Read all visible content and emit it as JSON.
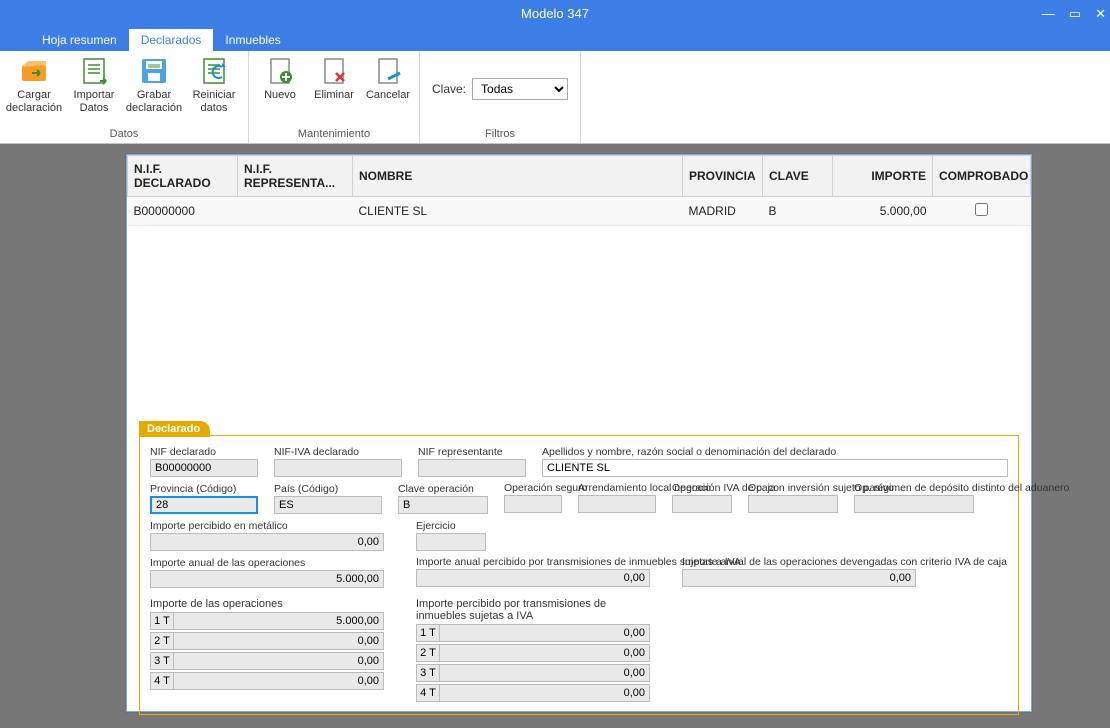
{
  "title": "Modelo 347",
  "tabs": {
    "resumen": "Hoja resumen",
    "declarados": "Declarados",
    "inmuebles": "Inmuebles"
  },
  "ribbon": {
    "datos": {
      "label": "Datos",
      "cargar": "Cargar declaración",
      "importar": "Importar Datos",
      "grabar": "Grabar declaración",
      "reiniciar": "Reiniciar datos"
    },
    "mant": {
      "label": "Mantenimiento",
      "nuevo": "Nuevo",
      "eliminar": "Eliminar",
      "cancelar": "Cancelar"
    },
    "filtros": {
      "label": "Filtros",
      "clave": "Clave:",
      "todas": "Todas"
    }
  },
  "grid": {
    "headers": {
      "nif": "N.I.F. DECLARADO",
      "nifrep": "N.I.F. REPRESENTA...",
      "nombre": "NOMBRE",
      "prov": "PROVINCIA",
      "clave": "CLAVE",
      "importe": "IMPORTE",
      "comp": "COMPROBADO"
    },
    "rows": [
      {
        "nif": "B00000000",
        "nifrep": "",
        "nombre": "CLIENTE SL",
        "prov": "MADRID",
        "clave": "B",
        "importe": "5.000,00",
        "comp": false
      }
    ]
  },
  "form": {
    "title": "Declarado",
    "labels": {
      "nif": "NIF declarado",
      "nifiva": "NIF-IVA declarado",
      "nifrep": "NIF representante",
      "nombre": "Apellidos y nombre, razón social o denominación del declarado",
      "prov": "Provincia (Código)",
      "pais": "País (Código)",
      "claveop": "Clave operación",
      "opseguro": "Operación seguro",
      "arrend": "Arrendamiento local negocio",
      "opivacaja": "Operación IVA de caja",
      "opinv": "Op. con inversión sujeto pasivo",
      "opadu": "Op. régimen de depósito distinto del aduanero",
      "metalico": "Importe percibido en metálico",
      "ejercicio": "Ejercicio",
      "anual": "Importe anual de las operaciones",
      "anualiva": "Importe anual percibido por transmisiones de inmuebles sujetas a IVA",
      "anualcaja": "Importe anual de las operaciones devengadas con criterio IVA de caja",
      "impops": "Importe de las operaciones",
      "imptrans": "Importe percibido por transmisiones de inmuebles sujetas a IVA"
    },
    "values": {
      "nif": "B00000000",
      "nifiva": "",
      "nifrep": "",
      "nombre": "CLIENTE SL",
      "prov": "28",
      "pais": "ES",
      "claveop": "B",
      "opseguro": "",
      "arrend": "",
      "opivacaja": "",
      "opinv": "",
      "opadu": "",
      "metalico": "0,00",
      "ejercicio": "",
      "anual": "5.000,00",
      "anualiva": "0,00",
      "anualcaja": "0,00",
      "ops": {
        "t1": "5.000,00",
        "t2": "0,00",
        "t3": "0,00",
        "t4": "0,00"
      },
      "trans": {
        "t1": "0,00",
        "t2": "0,00",
        "t3": "0,00",
        "t4": "0,00"
      }
    },
    "q": {
      "t1": "1 T",
      "t2": "2 T",
      "t3": "3 T",
      "t4": "4 T"
    }
  },
  "chart_data": {
    "type": "table",
    "headers": [
      "N.I.F. DECLARADO",
      "N.I.F. REPRESENTANTE",
      "NOMBRE",
      "PROVINCIA",
      "CLAVE",
      "IMPORTE",
      "COMPROBADO"
    ],
    "rows": [
      [
        "B00000000",
        "",
        "CLIENTE SL",
        "MADRID",
        "B",
        "5.000,00",
        false
      ]
    ]
  }
}
